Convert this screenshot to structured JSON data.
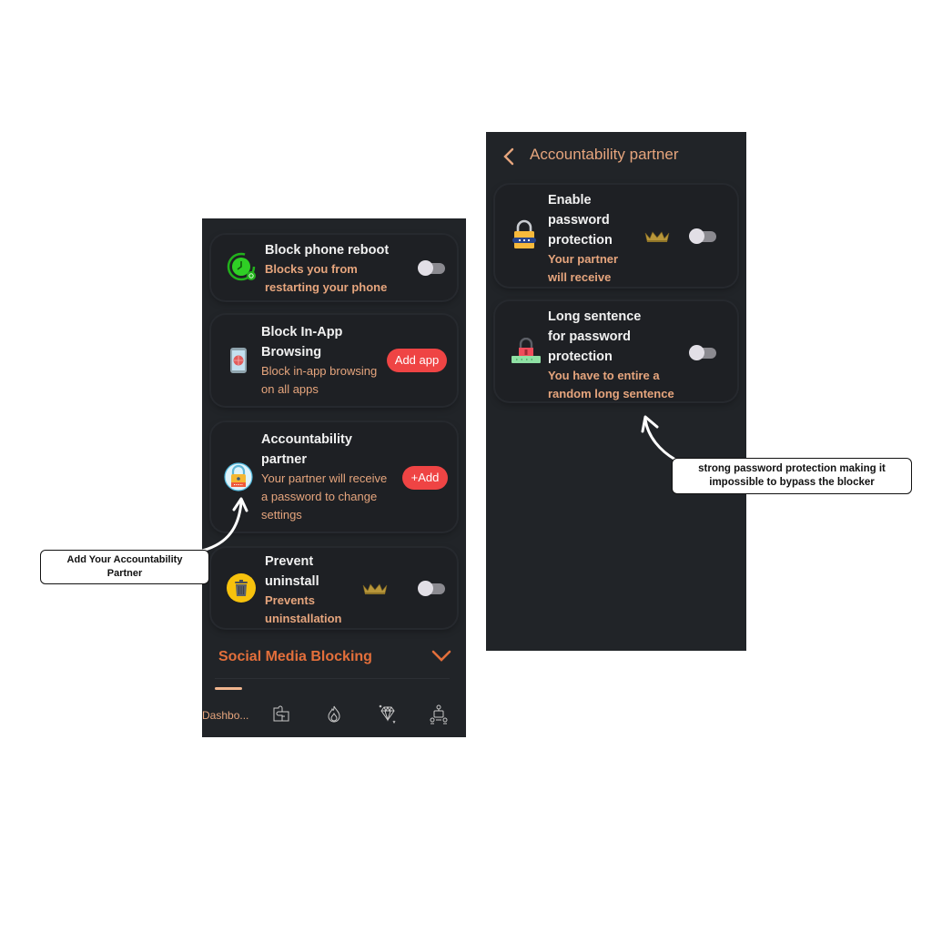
{
  "left_screen": {
    "cards": [
      {
        "title": "Block phone reboot",
        "subtitle": "Blocks you from restarting your phone",
        "icon": "reboot-clock-icon",
        "control": "toggle",
        "toggle_on": false
      },
      {
        "title": "Block In-App Browsing",
        "subtitle": "Block in-app browsing on all apps",
        "icon": "phone-globe-icon",
        "control": "button",
        "button_label": "Add app"
      },
      {
        "title": "Accountability partner",
        "subtitle": "Your partner will receive a password to change settings",
        "icon": "lock-shield-icon",
        "control": "button",
        "button_label": "+Add"
      },
      {
        "title": "Prevent uninstall",
        "subtitle": "Prevents uninstallation",
        "icon": "trash-icon",
        "premium": true,
        "control": "toggle",
        "toggle_on": false
      }
    ],
    "section": {
      "title": "Social Media Blocking",
      "expand_icon": "chevron-down-icon"
    },
    "tabbar": {
      "tabs": [
        {
          "label": "Dashbo...",
          "icon": "dashboard"
        },
        {
          "label": "",
          "icon": "puzzle-icon"
        },
        {
          "label": "",
          "icon": "fire-icon"
        },
        {
          "label": "",
          "icon": "diamond-icon"
        },
        {
          "label": "",
          "icon": "network-icon"
        }
      ]
    }
  },
  "right_screen": {
    "header": {
      "back_icon": "chevron-left-icon",
      "title": "Accountability partner"
    },
    "cards": [
      {
        "title_lines": [
          "Enable",
          "password",
          "protection"
        ],
        "subtitle_lines": [
          "Your partner",
          "will receive"
        ],
        "icon": "padlock-icon",
        "premium": true,
        "toggle_on": false
      },
      {
        "title_lines": [
          "Long sentence",
          "for password",
          "protection"
        ],
        "subtitle_lines": [
          "You have to entire a",
          "random long sentence"
        ],
        "icon": "red-padlock-icon",
        "premium": false,
        "toggle_on": false
      }
    ]
  },
  "callouts": {
    "left": [
      "Add Your Accountability",
      "Partner"
    ],
    "right": [
      "strong password protection making it",
      "impossible to bypass the blocker"
    ]
  }
}
